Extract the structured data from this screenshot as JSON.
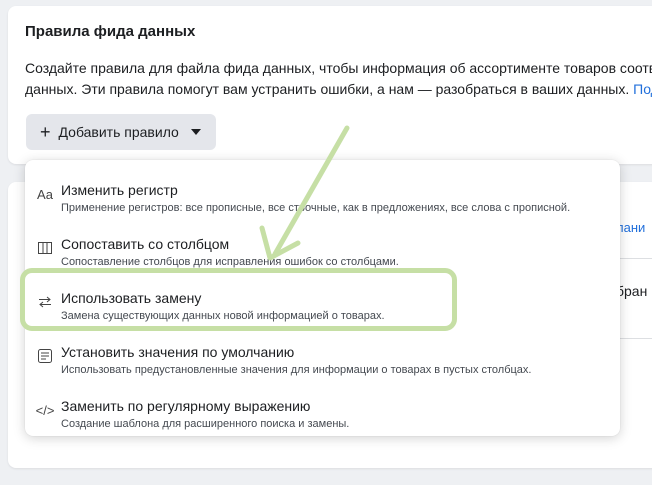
{
  "panel": {
    "title": "Правила фида данных",
    "description_line1": "Создайте правила для файла фида данных, чтобы информация об ассортименте товаров соотве",
    "description_line2": "данных. Эти правила помогут вам устранить ошибки, а нам — разобраться в ваших данных.",
    "description_link": "Подр",
    "add_rule_button": "Добавить правило"
  },
  "background": {
    "peek_link": "лани",
    "peek_text": "бран"
  },
  "menu": {
    "items": [
      {
        "icon": "text-case-icon",
        "label": "Изменить регистр",
        "sub": "Применение регистров: все прописные, все строчные, как в предложениях, все слова с прописной."
      },
      {
        "icon": "columns-icon",
        "label": "Сопоставить со столбцом",
        "sub": "Сопоставление столбцов для исправления ошибок со столбцами."
      },
      {
        "icon": "swap-arrows-icon",
        "label": "Использовать замену",
        "sub": "Замена существующих данных новой информацией о товарах."
      },
      {
        "icon": "list-form-icon",
        "label": "Установить значения по умолчанию",
        "sub": "Использовать предустановленные значения для информации о товарах в пустых столбцах."
      },
      {
        "icon": "code-icon",
        "label": "Заменить по регулярному выражению",
        "sub": "Создание шаблона для расширенного поиска и замены."
      }
    ]
  },
  "colors": {
    "highlight": "#c6dfa5",
    "arrow": "#c6dfa5",
    "link": "#216fdb"
  }
}
